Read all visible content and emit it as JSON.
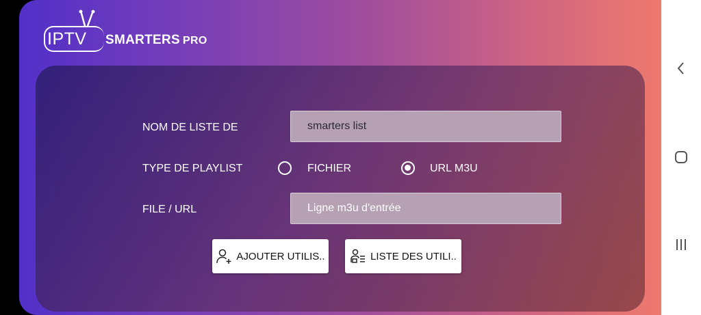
{
  "app": {
    "logo_iptv": "IPTV",
    "logo_smarters": "SMARTERS",
    "logo_pro": "PRO"
  },
  "form": {
    "playlist_name_label": "NOM DE LISTE DE",
    "playlist_name_value": "smarters list",
    "playlist_type_label": "TYPE DE PLAYLIST",
    "option_file": "FICHIER",
    "option_m3u": "URL M3U",
    "selected_option": "URL M3U",
    "file_url_label": "FILE / URL",
    "file_url_placeholder": "Ligne m3u d'entrée"
  },
  "buttons": {
    "add_user": "AJOUTER UTILIS..",
    "user_list": "LISTE DES UTILI.."
  },
  "icons": {
    "add_user": "add-user-icon",
    "user_list": "user-list-icon",
    "back": "back-icon",
    "home": "home-icon",
    "recents": "recents-icon"
  },
  "colors": {
    "gradient_start": "#5230c9",
    "gradient_end": "#ee7a6e",
    "field_bg": "#b5a0b4"
  }
}
